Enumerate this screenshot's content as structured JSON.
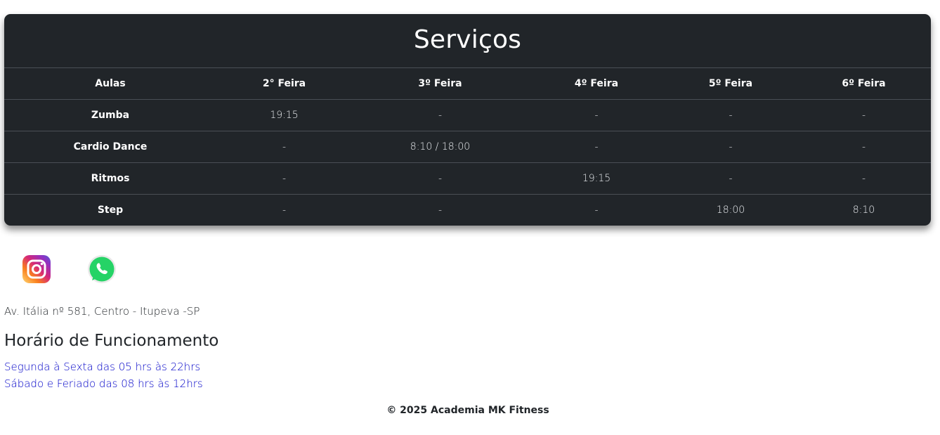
{
  "services": {
    "title": "Serviços",
    "headers": [
      "Aulas",
      "2° Feira",
      "3º Feira",
      "4º Feira",
      "5º Feira",
      "6º Feira"
    ],
    "rows": [
      {
        "name": "Zumba",
        "cells": [
          "19:15",
          "-",
          "-",
          "-",
          "-"
        ]
      },
      {
        "name": "Cardio Dance",
        "cells": [
          "-",
          "8:10 / 18:00",
          "-",
          "-",
          "-"
        ]
      },
      {
        "name": "Ritmos",
        "cells": [
          "-",
          "-",
          "19:15",
          "-",
          "-"
        ]
      },
      {
        "name": "Step",
        "cells": [
          "-",
          "-",
          "-",
          "18:00",
          "8:10"
        ]
      }
    ]
  },
  "social": {
    "icons": [
      "instagram-icon",
      "whatsapp-icon"
    ]
  },
  "address": "Av. Itália nº 581, Centro - Itupeva -SP",
  "hours": {
    "title": "Horário de Funcionamento",
    "lines": [
      "Segunda à Sexta das 05 hrs às 22hrs",
      "Sábado e Feriado das 08 hrs às 12hrs"
    ]
  },
  "footer": "© 2025 Academia MK Fitness",
  "colors": {
    "card_bg": "#212529",
    "link": "#0000c8",
    "whatsapp": "#25d366"
  }
}
